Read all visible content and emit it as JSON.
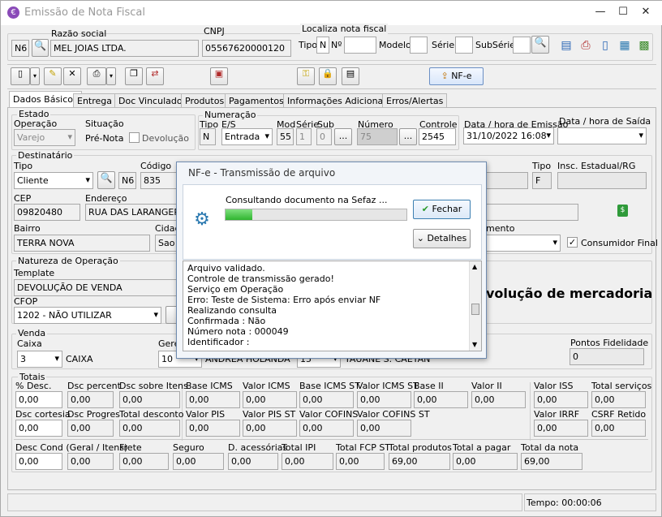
{
  "window": {
    "title": "Emissão de Nota Fiscal"
  },
  "header": {
    "razao_label": "Razão social",
    "cnpj_label": "CNPJ",
    "loc_label": "Localiza nota fiscal",
    "n6": "N6",
    "razao": "MEL JOIAS LTDA.",
    "cnpj": "05567620000120",
    "tipo_label": "Tipo",
    "tipo_val": "N",
    "no_label": "Nº",
    "modelo_label": "Modelo",
    "serie_label": "Série",
    "subserie_label": "SubSérie"
  },
  "toolbar": {
    "nfe_label": "NF-e"
  },
  "tabs": [
    {
      "label": "Dados Básicos"
    },
    {
      "label": "Entrega"
    },
    {
      "label": "Doc Vinculados"
    },
    {
      "label": "Produtos"
    },
    {
      "label": "Pagamentos"
    },
    {
      "label": "Informações Adicionais"
    },
    {
      "label": "Erros/Alertas"
    }
  ],
  "estado": {
    "title": "Estado",
    "operacao_label": "Operação",
    "operacao": "Varejo",
    "situacao_label": "Situação",
    "situacao": "Pré-Nota",
    "devolucao_label": "Devolução"
  },
  "numeracao": {
    "title": "Numeração",
    "tipo_label": "Tipo",
    "es_label": "E/S",
    "mod_label": "Mod",
    "serie_label": "Série",
    "sub_label": "Sub",
    "numero_label": "Número",
    "controle_label": "Controle",
    "tipo": "N",
    "es": "Entrada",
    "mod": "55",
    "serie": "1",
    "sub": "0",
    "numero": "75",
    "controle": "2545",
    "ellipsis": "..."
  },
  "datas": {
    "emissao_label": "Data / hora de Emissão",
    "emissao": "31/10/2022 16:08",
    "saida_label": "Data / hora de Saída"
  },
  "dest": {
    "title": "Destinatário",
    "tipo_label": "Tipo",
    "tipo": "Cliente",
    "n6": "N6",
    "codigo_label": "Código",
    "codigo": "835",
    "tipo2_label": "Tipo",
    "tipo2": "F",
    "insc_label": "Insc. Estadual/RG",
    "cep_label": "CEP",
    "cep": "09820480",
    "endereco_label": "Endereço",
    "endereco": "RUA DAS LARANGERAS",
    "bairro_label": "Bairro",
    "bairro": "TERRA NOVA",
    "cidade_label": "Cidad",
    "cidade": "Sao B",
    "atendimento_label": "mento",
    "consumidor_label": "Consumidor Final"
  },
  "natureza": {
    "title": "Natureza de Operação",
    "template_label": "Template",
    "template": "DEVOLUÇÃO DE VENDA",
    "cfop_label": "CFOP",
    "cfop": "1202  - NÃO UTILIZAR",
    "big_text": "volução de mercadoria"
  },
  "venda": {
    "title": "Venda",
    "caixa_label": "Caixa",
    "caixa": "3",
    "caixa_name": "CAIXA",
    "gerente_label": "Gere",
    "gerente": "10",
    "gerente_name": "ANDREA HOLANDA",
    "vendedor": "15",
    "vendedor_name": "TAUANE S. CAETAN",
    "pontos_label": "Pontos Fidelidade",
    "pontos": "0"
  },
  "totais": {
    "title": "Totais",
    "row1": [
      {
        "label": "% Desc.",
        "value": "0,00"
      },
      {
        "label": "Dsc percent",
        "value": "0,00"
      },
      {
        "label": "Dsc sobre Itens",
        "value": "0,00"
      },
      {
        "label": "Base ICMS",
        "value": "0,00"
      },
      {
        "label": "Valor ICMS",
        "value": "0,00"
      },
      {
        "label": "Base ICMS ST",
        "value": "0,00"
      },
      {
        "label": "Valor ICMS ST",
        "value": "0,00"
      },
      {
        "label": "Base II",
        "value": "0,00"
      },
      {
        "label": "Valor II",
        "value": "0,00"
      },
      {
        "label": "Valor ISS",
        "value": "0,00"
      },
      {
        "label": "Total serviços",
        "value": "0,00"
      }
    ],
    "row2": [
      {
        "label": "Dsc cortesia",
        "value": "0,00"
      },
      {
        "label": "Dsc Progres",
        "value": "0,00"
      },
      {
        "label": "Total desconto",
        "value": "0,00"
      },
      {
        "label": "Valor PIS",
        "value": "0,00"
      },
      {
        "label": "Valor PIS ST",
        "value": "0,00"
      },
      {
        "label": "Valor COFINS",
        "value": "0,00"
      },
      {
        "label": "Valor COFINS ST",
        "value": "0,00"
      },
      {
        "label": "Valor IRRF",
        "value": "0,00"
      },
      {
        "label": "CSRF Retido",
        "value": "0,00"
      }
    ],
    "row3": [
      {
        "label": "Desc Cond (Geral / Itens)",
        "value": "0,00"
      },
      {
        "label": "",
        "value": "0,00"
      },
      {
        "label": "Frete",
        "value": "0,00"
      },
      {
        "label": "Seguro",
        "value": "0,00"
      },
      {
        "label": "D. acessórias",
        "value": "0,00"
      },
      {
        "label": "Total IPI",
        "value": "0,00"
      },
      {
        "label": "Total FCP ST",
        "value": "0,00"
      },
      {
        "label": "Total produtos",
        "value": "69,00"
      },
      {
        "label": "Total a pagar",
        "value": "0,00"
      },
      {
        "label": "Total da nota",
        "value": "69,00"
      }
    ]
  },
  "dialog": {
    "title": "NF-e - Transmissão de arquivo",
    "status": "Consultando documento na Sefaz ...",
    "progress": 0.15,
    "fechar": "Fechar",
    "detalhes": "Detalhes",
    "log": [
      "Arquivo validado.",
      "Controle de transmissão gerado!",
      "Serviço em Operação",
      "Erro: Teste de Sistema: Erro após enviar NF",
      "Realizando consulta",
      "Confirmada : Não",
      "Número nota : 000049",
      "Identificador :"
    ]
  },
  "status": {
    "tempo": "Tempo: 00:00:06"
  }
}
